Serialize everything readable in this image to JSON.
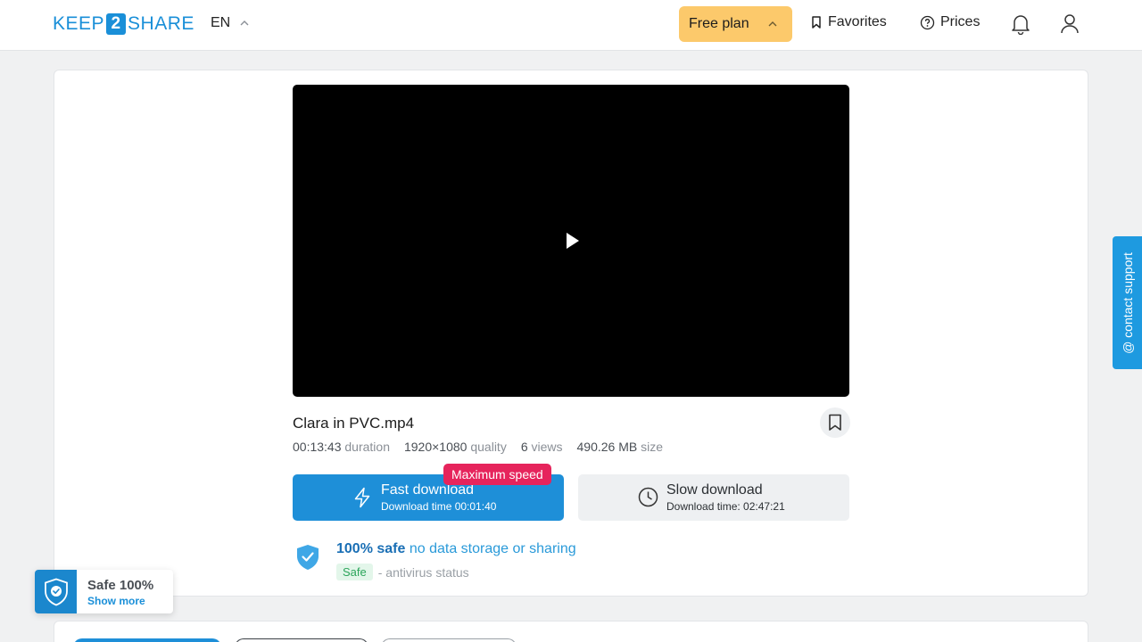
{
  "header": {
    "logo_left": "KEEP",
    "logo_mid": "2",
    "logo_right": "SHARE",
    "language": "EN",
    "plan_label": "Free plan",
    "favorites_label": "Favorites",
    "prices_label": "Prices"
  },
  "file": {
    "name": "Clara in PVC.mp4",
    "duration_value": "00:13:43",
    "duration_label": "duration",
    "quality_value": "1920×1080",
    "quality_label": "quality",
    "views_value": "6",
    "views_label": "views",
    "size_value": "490.26 MB",
    "size_label": "size"
  },
  "downloads": {
    "fast_title": "Fast download",
    "fast_sub": "Download time 00:01:40",
    "fast_badge": "Maximum speed",
    "slow_title": "Slow download",
    "slow_sub": "Download time: 02:47:21"
  },
  "safety": {
    "strong": "100% safe",
    "rest": "no data storage or sharing",
    "tag": "Safe",
    "status": "- antivirus status"
  },
  "support_label": "@ contact support",
  "safe_widget": {
    "title": "Safe 100%",
    "link": "Show more"
  },
  "colors": {
    "brand_blue": "#1e8fd8",
    "plan_yellow": "#fcc96b",
    "badge_red": "#e6245c"
  }
}
